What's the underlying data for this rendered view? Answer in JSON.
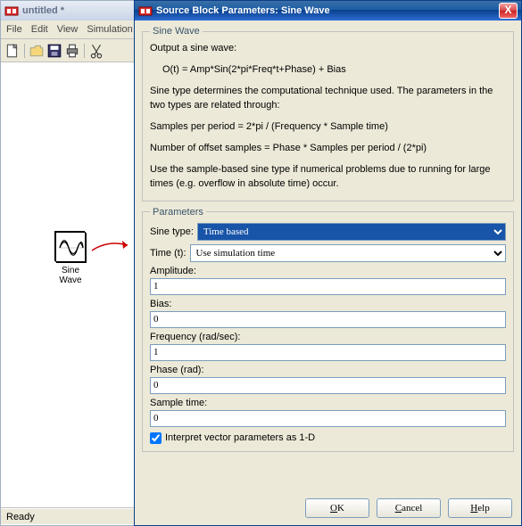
{
  "model_window": {
    "title": "untitled *",
    "menus": [
      "File",
      "Edit",
      "View",
      "Simulation"
    ],
    "status": "Ready",
    "block_label": "Sine Wave"
  },
  "dialog": {
    "title": "Source Block Parameters: Sine Wave",
    "close": "X",
    "sine_wave": {
      "legend": "Sine Wave",
      "p1": "Output a sine wave:",
      "p2": "O(t) = Amp*Sin(2*pi*Freq*t+Phase) + Bias",
      "p3": "Sine type determines the computational technique used. The parameters in the two types are related through:",
      "p4": "Samples per period = 2*pi / (Frequency * Sample time)",
      "p5": "Number of offset samples = Phase * Samples per period / (2*pi)",
      "p6": "Use the sample-based sine type if numerical problems due to running for large times (e.g. overflow in absolute time) occur."
    },
    "params": {
      "legend": "Parameters",
      "sine_type_label": "Sine type:",
      "sine_type_value": "Time based",
      "time_t_label": "Time (t):",
      "time_t_value": "Use simulation time",
      "amplitude_label": "Amplitude:",
      "amplitude_value": "1",
      "bias_label": "Bias:",
      "bias_value": "0",
      "frequency_label": "Frequency (rad/sec):",
      "frequency_value": "1",
      "phase_label": "Phase (rad):",
      "phase_value": "0",
      "sample_time_label": "Sample time:",
      "sample_time_value": "0",
      "interpret_label": "Interpret vector parameters as 1-D"
    },
    "buttons": {
      "ok": "OK",
      "cancel": "Cancel",
      "help": "Help"
    }
  }
}
